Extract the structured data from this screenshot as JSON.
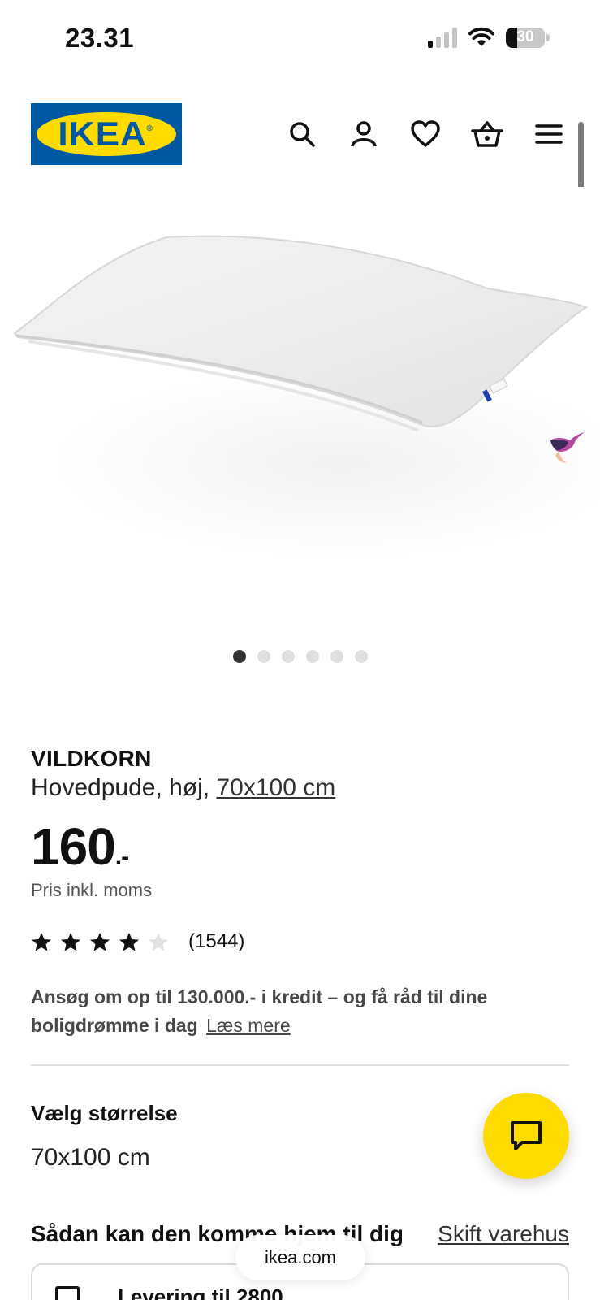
{
  "status_bar": {
    "time": "23.31",
    "battery": "30",
    "battery_level": 0.3
  },
  "header": {
    "logo_text": "IKEA",
    "icons": [
      "search-icon",
      "account-icon",
      "heart-icon",
      "basket-icon",
      "menu-icon"
    ]
  },
  "gallery": {
    "image_count": 6,
    "active_index": 0
  },
  "product": {
    "name": "VILDKORN",
    "description": "Hovedpude, høj, ",
    "size_link": "70x100 cm",
    "price_main": "160",
    "price_suffix": ".-",
    "price_note": "Pris inkl. moms",
    "rating_value": 4,
    "rating_max": 5,
    "rating_count": "(1544)"
  },
  "credit": {
    "text": "Ansøg om op til 130.000.- i kredit – og få råd til dine boligdrømme i dag",
    "link": "Læs mere"
  },
  "size_selector": {
    "label": "Vælg størrelse",
    "value": "70x100 cm"
  },
  "delivery": {
    "title": "Sådan kan den komme hjem til dig",
    "change_store": "Skift varehus",
    "card_text": "Levering til 2800"
  },
  "browser": {
    "url": "ikea.com"
  },
  "colors": {
    "ikea_blue": "#0058a3",
    "ikea_yellow": "#ffdb00"
  }
}
